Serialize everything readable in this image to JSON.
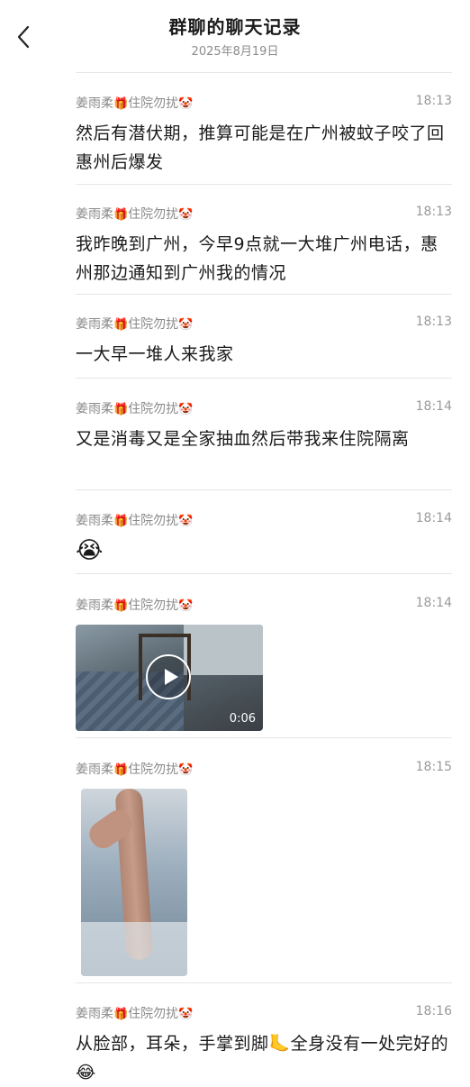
{
  "header": {
    "title": "群聊的聊天记录",
    "date": "2025年8月19日"
  },
  "messages": [
    {
      "sender": "姜雨柔",
      "status": "住院勿扰",
      "time": "18:13",
      "text": "然后有潜伏期，推算可能是在广州被蚊子咬了回惠州后爆发"
    },
    {
      "sender": "姜雨柔",
      "status": "住院勿扰",
      "time": "18:13",
      "text": "我昨晚到广州，今早9点就一大堆广州电话，惠州那边通知到广州我的情况"
    },
    {
      "sender": "姜雨柔",
      "status": "住院勿扰",
      "time": "18:13",
      "text": "一大早一堆人来我家"
    },
    {
      "sender": "姜雨柔",
      "status": "住院勿扰",
      "time": "18:14",
      "text": "又是消毒又是全家抽血然后带我来住院隔离"
    },
    {
      "sender": "姜雨柔",
      "status": "住院勿扰",
      "time": "18:14",
      "emoji": "😭"
    },
    {
      "sender": "姜雨柔",
      "status": "住院勿扰",
      "time": "18:14",
      "video_duration": "0:06"
    },
    {
      "sender": "姜雨柔",
      "status": "住院勿扰",
      "time": "18:15"
    },
    {
      "sender": "姜雨柔",
      "status": "住院勿扰",
      "time": "18:16",
      "text": "从脸部，耳朵，手掌到脚🦶全身没有一处完好的😂"
    }
  ],
  "icons": {
    "back": "chevron-left-icon",
    "gift_emoji": "🎁",
    "clown_emoji": "🤡"
  }
}
